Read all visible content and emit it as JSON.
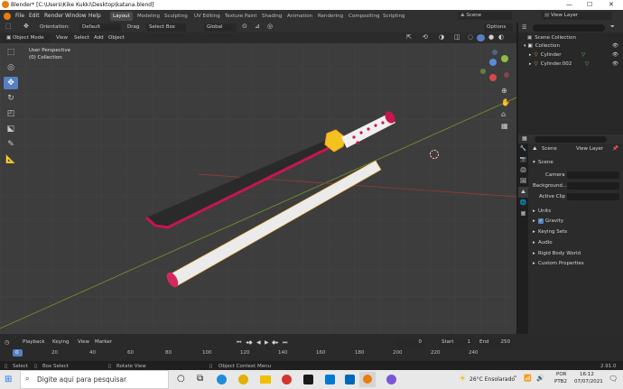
{
  "window": {
    "title": "Blender* [C:\\Users\\Kike Kukki\\Desktop\\katana.blend]"
  },
  "menu": [
    "File",
    "Edit",
    "Render",
    "Window",
    "Help"
  ],
  "workspaces": [
    {
      "label": "Layout",
      "active": true
    },
    {
      "label": "Modeling"
    },
    {
      "label": "Sculpting"
    },
    {
      "label": "UV Editing"
    },
    {
      "label": "Texture Paint"
    },
    {
      "label": "Shading"
    },
    {
      "label": "Animation"
    },
    {
      "label": "Rendering"
    },
    {
      "label": "Compositing"
    },
    {
      "label": "Scripting"
    }
  ],
  "scene_selector": "Scene",
  "view_layer_selector": "View Layer",
  "tool_header": {
    "orientation_label": "Orientation:",
    "orientation_value": "Default",
    "drag_label": "Drag",
    "drag_value": "Select Box",
    "transform_value": "Global",
    "options_label": "Options"
  },
  "viewport_header": {
    "mode": "Object Mode",
    "menus": [
      "View",
      "Select",
      "Add",
      "Object"
    ]
  },
  "viewport": {
    "perspective_label": "User Perspective",
    "collection_label": "(0) Collection"
  },
  "outliner": {
    "root": "Scene Collection",
    "collection": "Collection",
    "objects": [
      "Cylinder",
      "Cylinder.002"
    ]
  },
  "properties": {
    "tabs": [
      "Scene",
      "View Layer"
    ],
    "section_title": "Scene",
    "fields": [
      {
        "label": "Camera"
      },
      {
        "label": "Background..."
      },
      {
        "label": "Active Clip"
      }
    ],
    "panels": [
      "Units",
      "Gravity",
      "Keying Sets",
      "Audio",
      "Rigid Body World",
      "Custom Properties"
    ],
    "gravity_checked": true
  },
  "timeline": {
    "menus": [
      "Playback",
      "Keying",
      "View",
      "Marker"
    ],
    "current_frame": "0",
    "start_label": "Start",
    "start_value": "1",
    "end_label": "End",
    "end_value": "250",
    "ticks": [
      "0",
      "20",
      "40",
      "60",
      "80",
      "100",
      "120",
      "140",
      "160",
      "180",
      "200",
      "220",
      "240"
    ]
  },
  "status_bar": {
    "select": "Select",
    "box_select": "Box Select",
    "rotate_view": "Rotate View",
    "context_menu": "Object Context Menu",
    "version": "2.91.0"
  },
  "taskbar": {
    "search_placeholder": "Digite aqui para pesquisar",
    "weather": "26°C  Ensolarado",
    "lang": "POR",
    "lang_sub": "PTB2",
    "time": "16:12",
    "date": "07/07/2021"
  },
  "colors": {
    "accent": "#5680c2",
    "active_object": "#f5a623",
    "blade_red": "#c8164e"
  }
}
